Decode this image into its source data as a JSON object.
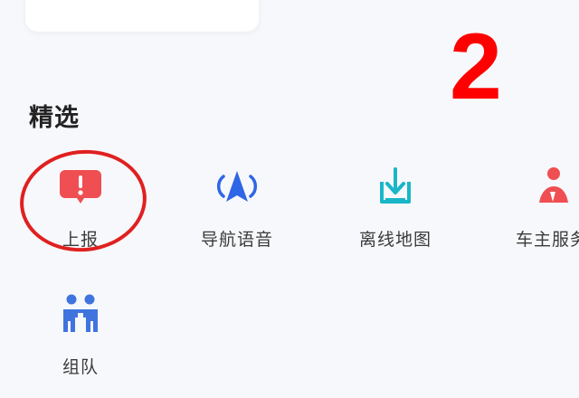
{
  "section_title": "精选",
  "annotation_number": "2",
  "items": [
    {
      "label": "上报",
      "icon": "report-alert-icon",
      "color": "#ef4f52"
    },
    {
      "label": "导航语音",
      "icon": "navigation-voice-icon",
      "color": "#2f66e6"
    },
    {
      "label": "离线地图",
      "icon": "offline-map-download-icon",
      "color": "#19b6c8"
    },
    {
      "label": "车主服务",
      "icon": "car-owner-service-icon",
      "color": "#ef4f52"
    },
    {
      "label": "组队",
      "icon": "team-icon",
      "color": "#3f74df"
    }
  ],
  "colors": {
    "background": "#f7f8fb",
    "annotation_red": "#ff0000",
    "circle_red": "#e02020"
  }
}
